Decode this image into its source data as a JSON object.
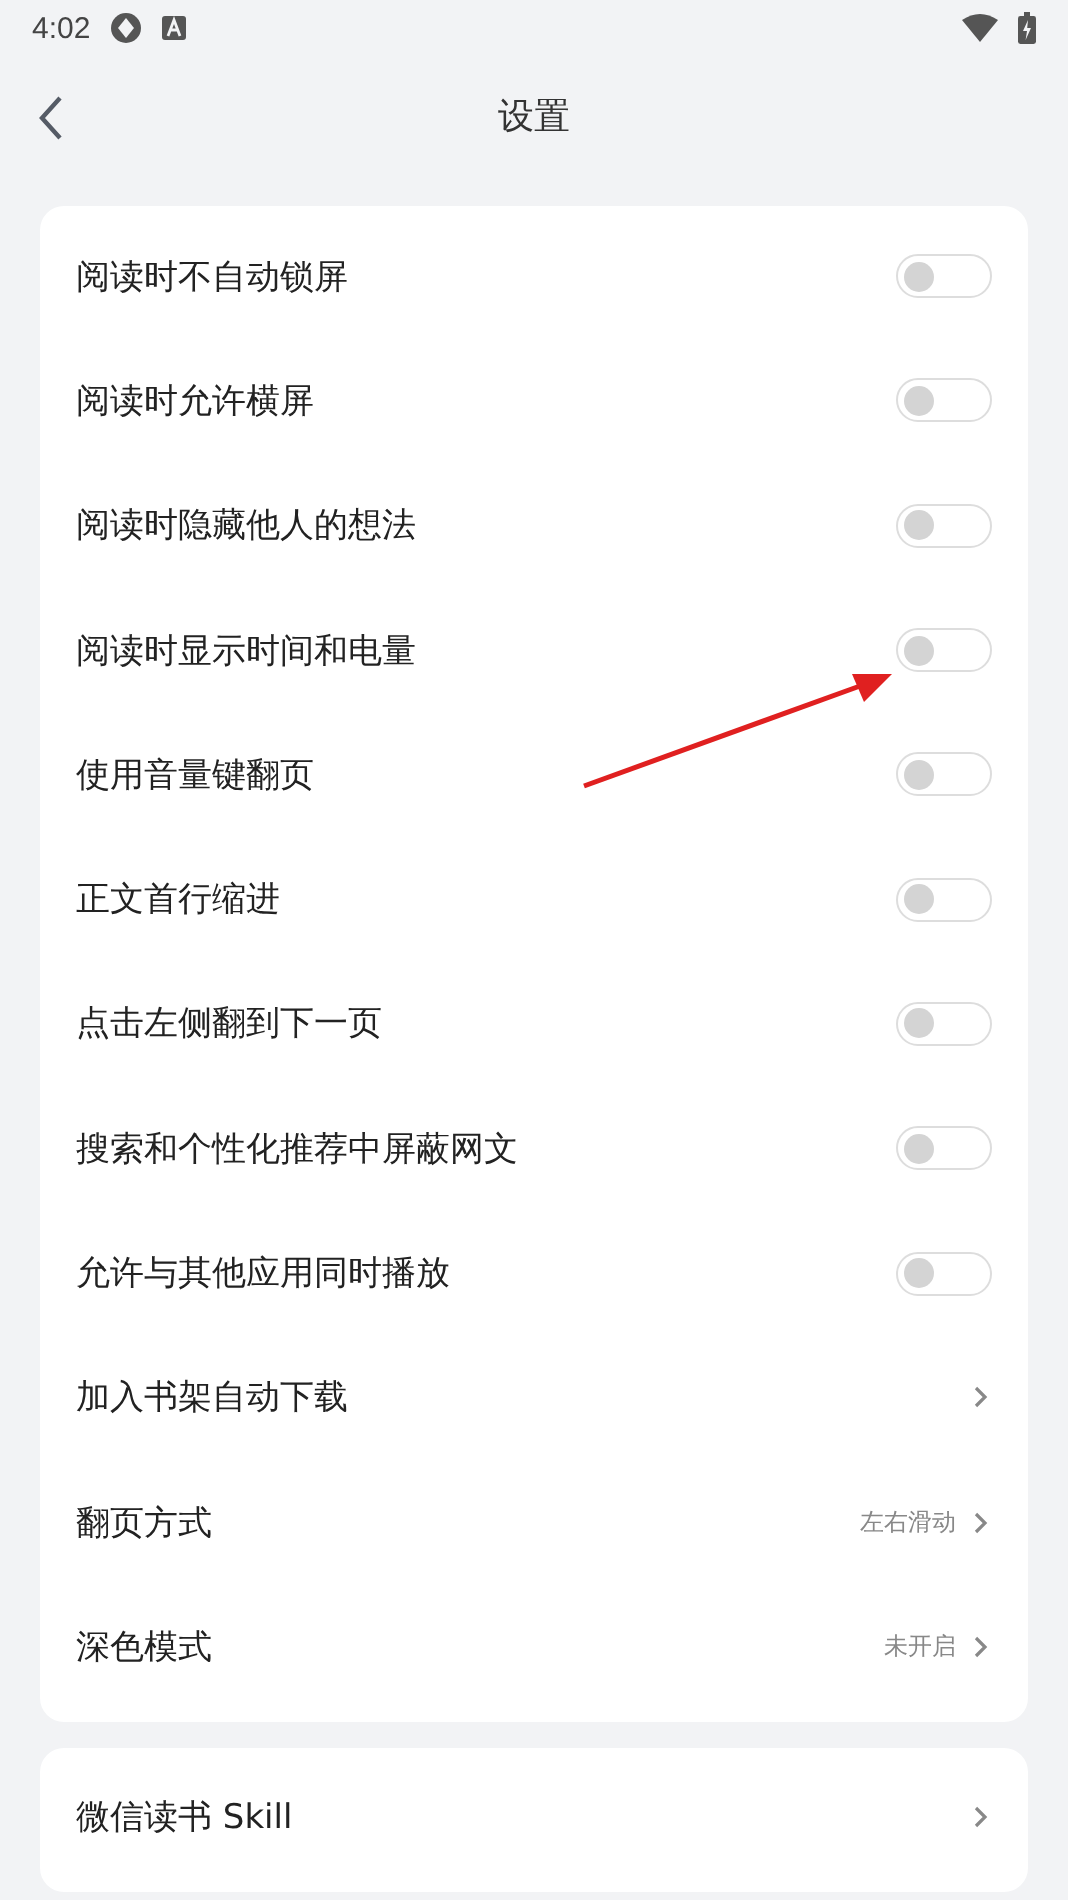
{
  "status_bar": {
    "time": "4:02"
  },
  "header": {
    "title": "设置"
  },
  "groups": [
    {
      "items": [
        {
          "kind": "toggle",
          "label": "阅读时不自动锁屏",
          "on": false
        },
        {
          "kind": "toggle",
          "label": "阅读时允许横屏",
          "on": false
        },
        {
          "kind": "toggle",
          "label": "阅读时隐藏他人的想法",
          "on": false
        },
        {
          "kind": "toggle",
          "label": "阅读时显示时间和电量",
          "on": false
        },
        {
          "kind": "toggle",
          "label": "使用音量键翻页",
          "on": false
        },
        {
          "kind": "toggle",
          "label": "正文首行缩进",
          "on": false
        },
        {
          "kind": "toggle",
          "label": "点击左侧翻到下一页",
          "on": false
        },
        {
          "kind": "toggle",
          "label": "搜索和个性化推荐中屏蔽网文",
          "on": false
        },
        {
          "kind": "toggle",
          "label": "允许与其他应用同时播放",
          "on": false
        },
        {
          "kind": "link",
          "label": "加入书架自动下载"
        },
        {
          "kind": "link",
          "label": "翻页方式",
          "value": "左右滑动"
        },
        {
          "kind": "link",
          "label": "深色模式",
          "value": "未开启"
        }
      ]
    },
    {
      "items": [
        {
          "kind": "link",
          "label": "微信读书 Skill"
        }
      ]
    }
  ]
}
